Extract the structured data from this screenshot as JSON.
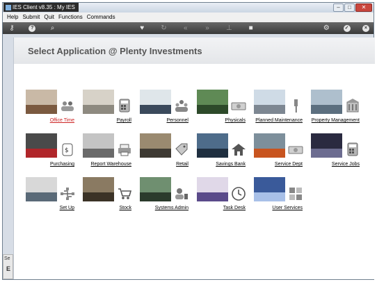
{
  "window": {
    "title": "IES Client v8.35 : My IES"
  },
  "menu": [
    "Help",
    "Submit",
    "Quit",
    "Functions",
    "Commands"
  ],
  "toolbar": {
    "icons": [
      "key-icon",
      "help-icon",
      "search-icon",
      "heart-icon",
      "refresh-icon",
      "rewind-icon",
      "fast-forward-icon",
      "pin-icon",
      "stop-icon",
      "settings-icon",
      "confirm-icon",
      "close-icon"
    ]
  },
  "main": {
    "title": "Select Application @  Plenty Investments",
    "apps": [
      {
        "label": "Office Time",
        "icon": "people-icon",
        "active": true,
        "photo": [
          "#c9b9a6",
          "#7b5a40"
        ]
      },
      {
        "label": "Payroll",
        "icon": "calculator-icon",
        "active": false,
        "photo": [
          "#d7d2c8",
          "#8e8a80"
        ]
      },
      {
        "label": "Personnel",
        "icon": "team-icon",
        "active": false,
        "photo": [
          "#dfe6ea",
          "#3b4a5c"
        ]
      },
      {
        "label": "Physicals",
        "icon": "cash-icon",
        "active": false,
        "photo": [
          "#5f8a55",
          "#2d4a2a"
        ]
      },
      {
        "label": "Planned Maintenance",
        "icon": "pin-icon",
        "active": false,
        "photo": [
          "#cfdbe6",
          "#7d8792"
        ]
      },
      {
        "label": "Property Management",
        "icon": "building-icon",
        "active": false,
        "photo": [
          "#aebfcd",
          "#5c6f7f"
        ]
      },
      {
        "label": "Purchasing",
        "icon": "invoice-icon",
        "active": false,
        "photo": [
          "#4a4a4a",
          "#b0262a"
        ]
      },
      {
        "label": "Report Warehouse",
        "icon": "printer-icon",
        "active": false,
        "photo": [
          "#c4c4c4",
          "#6a6a6a"
        ]
      },
      {
        "label": "Retail",
        "icon": "tag-icon",
        "active": false,
        "photo": [
          "#9a8a70",
          "#3e3a33"
        ]
      },
      {
        "label": "Savings Bank",
        "icon": "home-icon",
        "active": false,
        "photo": [
          "#4e6c8a",
          "#1f2f40"
        ]
      },
      {
        "label": "Service Dept",
        "icon": "cash-icon",
        "active": false,
        "photo": [
          "#7d8f9b",
          "#c8541f"
        ]
      },
      {
        "label": "Service Jobs",
        "icon": "calculator-icon",
        "active": false,
        "photo": [
          "#2a2a40",
          "#6c6c90"
        ]
      },
      {
        "label": "Set Up",
        "icon": "network-icon",
        "active": false,
        "photo": [
          "#d8d8d8",
          "#5a6a78"
        ]
      },
      {
        "label": "Stock",
        "icon": "cart-icon",
        "active": false,
        "photo": [
          "#8a7a62",
          "#3b3226"
        ]
      },
      {
        "label": "Systems Admin",
        "icon": "admin-icon",
        "active": false,
        "photo": [
          "#6f8f70",
          "#2b3b2c"
        ]
      },
      {
        "label": "Task Desk",
        "icon": "clock-icon",
        "active": false,
        "photo": [
          "#e0d8e8",
          "#5a4a8a"
        ]
      },
      {
        "label": "User Services",
        "icon": "apps-icon",
        "active": false,
        "photo": [
          "#3a5a9a",
          "#a8c0e8"
        ]
      }
    ]
  },
  "side_tab": {
    "line1": "Se",
    "line2": "E"
  },
  "colors": {
    "active_label": "#cc2222",
    "title": "#555555",
    "toolbar": "#4a4a4a"
  }
}
